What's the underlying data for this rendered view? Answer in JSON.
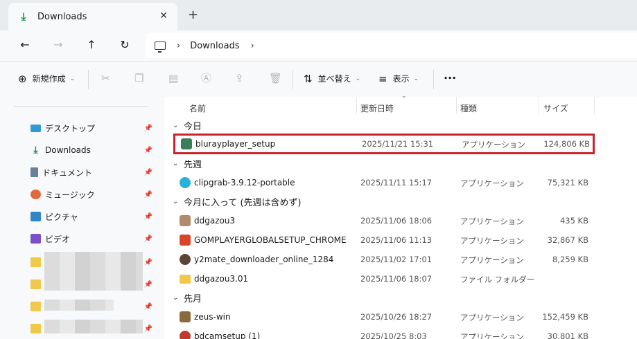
{
  "tab": {
    "title": "Downloads",
    "close": "✕",
    "new": "+"
  },
  "nav": {
    "back": "←",
    "forward": "→",
    "up": "↑",
    "refresh": "↻"
  },
  "address": {
    "sep1": "›",
    "crumb": "Downloads",
    "sep2": "›"
  },
  "commands": {
    "new_label": "新規作成",
    "sort_label": "並べ替え",
    "view_label": "表示",
    "more": "···"
  },
  "sidebar": {
    "items": [
      {
        "label": "デスクトップ"
      },
      {
        "label": "Downloads"
      },
      {
        "label": "ドキュメント"
      },
      {
        "label": "ミュージック"
      },
      {
        "label": "ピクチャ"
      },
      {
        "label": "ビデオ"
      }
    ]
  },
  "columns": {
    "name": "名前",
    "date": "更新日時",
    "type": "種類",
    "size": "サイズ"
  },
  "groups": {
    "today": "今日",
    "lastweek": "先週",
    "thismonth": "今月に入って (先週は含めず)",
    "lastmonth": "先月"
  },
  "files": [
    {
      "name": "blurayplayer_setup",
      "date": "2025/11/21 15:31",
      "type": "アプリケーション",
      "size": "124,806 KB",
      "color": "#3a7d5a"
    },
    {
      "name": "clipgrab-3.9.12-portable",
      "date": "2025/11/11 15:17",
      "type": "アプリケーション",
      "size": "75,321 KB",
      "color": "#2ab0d9"
    },
    {
      "name": "ddgazou3",
      "date": "2025/11/06 18:06",
      "type": "アプリケーション",
      "size": "435 KB",
      "color": "#b08a6a"
    },
    {
      "name": "GOMPLAYERGLOBALSETUP_CHROME",
      "date": "2025/11/06 11:13",
      "type": "アプリケーション",
      "size": "32,867 KB",
      "color": "#d9452b"
    },
    {
      "name": "y2mate_downloader_online_1284",
      "date": "2025/11/02 17:01",
      "type": "アプリケーション",
      "size": "8,259 KB",
      "color": "#5a4632"
    },
    {
      "name": "ddgazou3.01",
      "date": "2025/11/06 18:07",
      "type": "ファイル フォルダー",
      "size": "",
      "color": "#f2c84b"
    },
    {
      "name": "zeus-win",
      "date": "2025/10/26 18:27",
      "type": "アプリケーション",
      "size": "152,459 KB",
      "color": "#8a6a3a"
    },
    {
      "name": "bdcamsetup (1)",
      "date": "2025/10/25 8:03",
      "type": "アプリケーション",
      "size": "30,801 KB",
      "color": "#c0392b"
    }
  ]
}
